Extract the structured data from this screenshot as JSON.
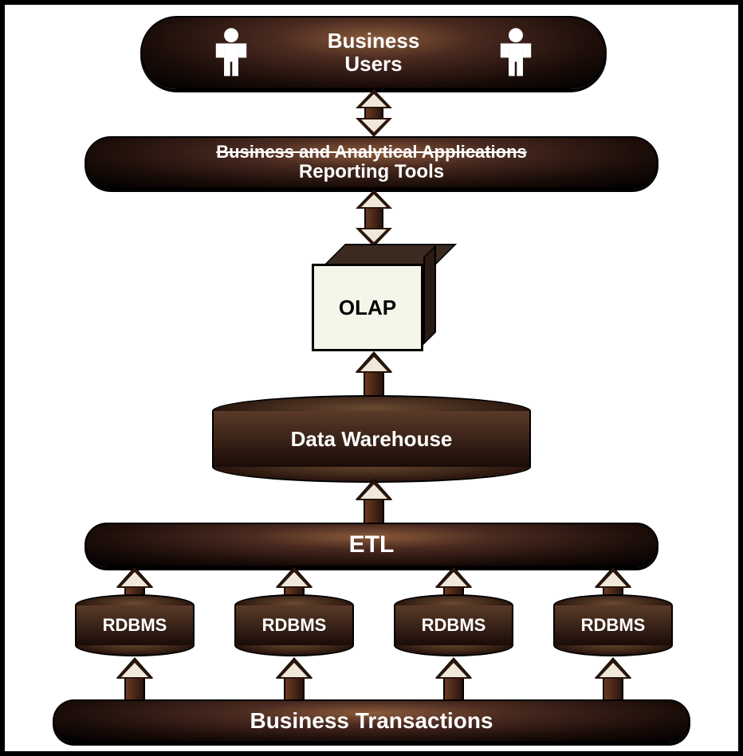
{
  "diagram": {
    "users_layer": {
      "line1": "Business",
      "line2": "Users"
    },
    "reporting_layer": {
      "line1": "Business and Analytical Applications",
      "line2": "Reporting Tools"
    },
    "olap_label": "OLAP",
    "data_warehouse_label": "Data Warehouse",
    "etl_label": "ETL",
    "rdbms": [
      "RDBMS",
      "RDBMS",
      "RDBMS",
      "RDBMS"
    ],
    "transactions_label": "Business Transactions"
  }
}
